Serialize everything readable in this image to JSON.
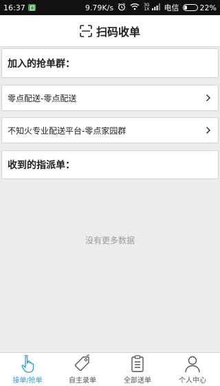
{
  "status_bar": {
    "time": "16:37",
    "speed": "9.79K/s",
    "net_top": "3G",
    "net_bottom": "1X",
    "carrier": "电信",
    "battery": "22%",
    "battery_level": 0.22
  },
  "header": {
    "title": "扫码收单",
    "icon": "scan-icon"
  },
  "joined_groups": {
    "title": "加入的抢单群：",
    "items": [
      {
        "label": "零点配送-零点配送"
      },
      {
        "label": "不知火专业配送平台-零点家园群"
      }
    ]
  },
  "assigned_orders": {
    "title": "收到的指派单："
  },
  "empty_text": "没有更多数据",
  "tabs": [
    {
      "label": "接单/抢单",
      "icon": "tap-hand-icon",
      "active": true
    },
    {
      "label": "自主录单",
      "icon": "tag-icon",
      "active": false
    },
    {
      "label": "全部送单",
      "icon": "clipboard-icon",
      "active": false
    },
    {
      "label": "个人中心",
      "icon": "person-icon",
      "active": false
    }
  ],
  "colors": {
    "accent": "#2a9ad8",
    "background": "#ececec",
    "status_bar": "#111111"
  }
}
